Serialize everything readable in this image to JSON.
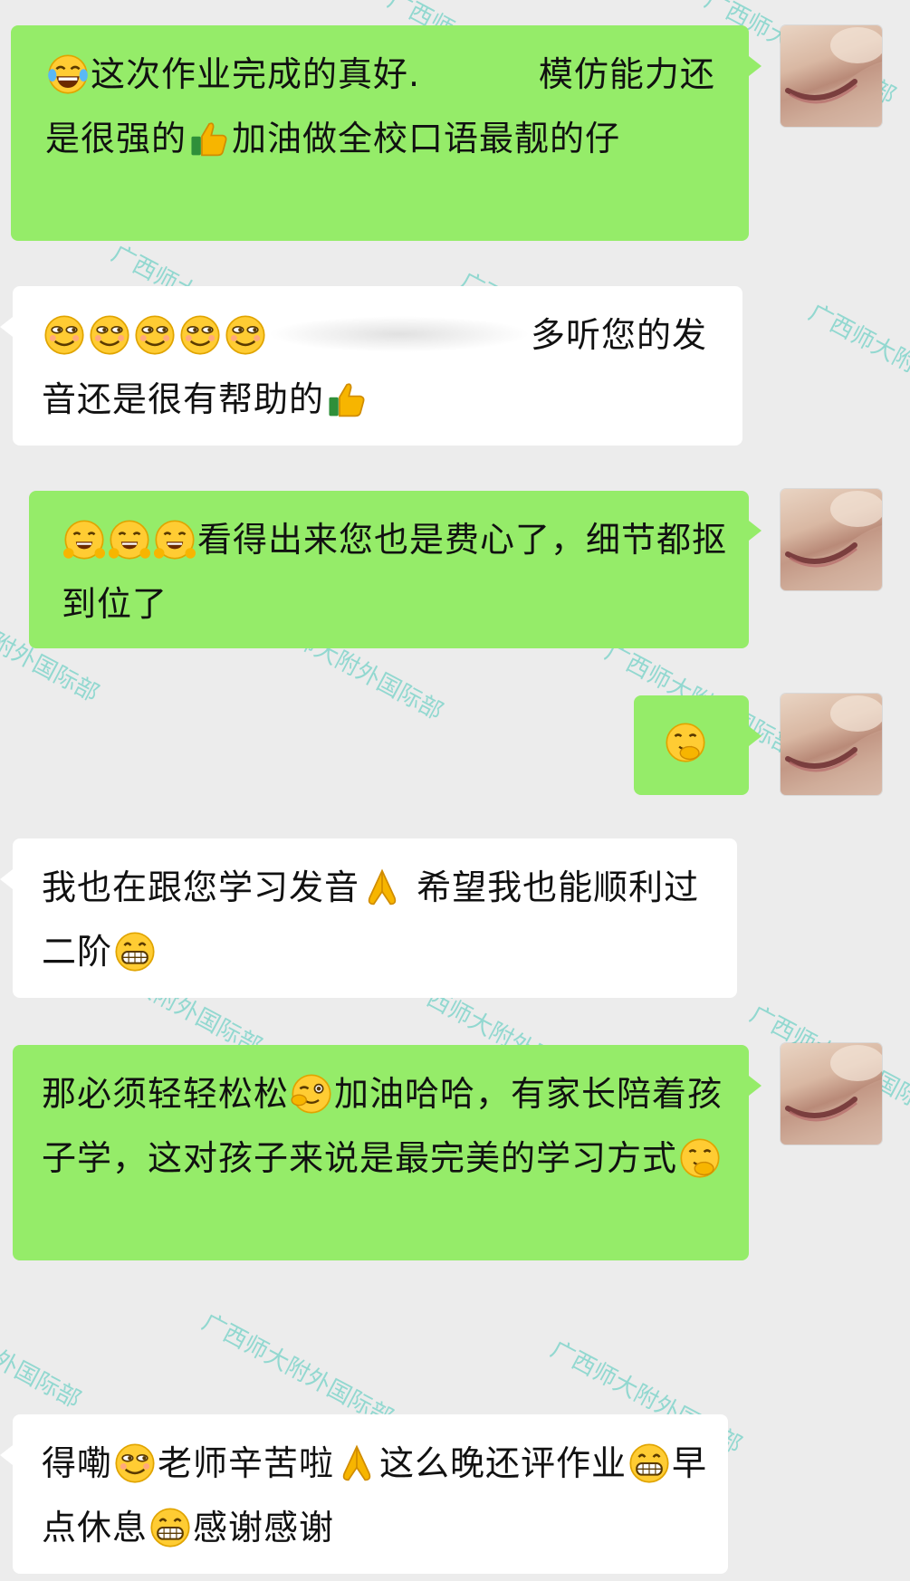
{
  "watermark_text": "广西师大附外国际部",
  "messages": [
    {
      "side": "right",
      "parts": [
        {
          "emoji": "laugh-tears-icon"
        },
        {
          "text": "这次作业完成的真好.          模仿能力还是很强的"
        },
        {
          "emoji": "thumbs-up-icon"
        },
        {
          "text": "加油做全校口语最靓的仔"
        }
      ]
    },
    {
      "side": "left",
      "parts": [
        {
          "emoji": "smirk-icon"
        },
        {
          "emoji": "smirk-icon"
        },
        {
          "emoji": "smirk-icon"
        },
        {
          "emoji": "smirk-icon"
        },
        {
          "emoji": "smirk-icon"
        },
        {
          "text": "多听您的发音还是很有帮助的"
        },
        {
          "emoji": "thumbs-up-icon"
        }
      ]
    },
    {
      "side": "right",
      "parts": [
        {
          "emoji": "grin-hands-icon"
        },
        {
          "emoji": "grin-hands-icon"
        },
        {
          "emoji": "grin-hands-icon"
        },
        {
          "text": "看得出来您也是费心了，细节都抠到位了"
        }
      ]
    },
    {
      "side": "right",
      "parts": [
        {
          "emoji": "chuckle-icon"
        }
      ]
    },
    {
      "side": "left",
      "parts": [
        {
          "text": "我也在跟您学习发音"
        },
        {
          "emoji": "pray-icon"
        },
        {
          "text": " 希望我也能顺利过二阶"
        },
        {
          "emoji": "big-grin-icon"
        }
      ]
    },
    {
      "side": "right",
      "parts": [
        {
          "text": "那必须轻轻松松"
        },
        {
          "emoji": "wink-icon"
        },
        {
          "text": "加油哈哈，有家长陪着孩子学，这对孩子来说是最完美的学习方式"
        },
        {
          "emoji": "chuckle-icon"
        }
      ]
    },
    {
      "side": "left",
      "parts": [
        {
          "text": "得嘞"
        },
        {
          "emoji": "smirk-icon"
        },
        {
          "text": "老师辛苦啦"
        },
        {
          "emoji": "pray-icon"
        },
        {
          "text": "这么晚还评作业"
        },
        {
          "emoji": "big-grin-icon"
        },
        {
          "text": "早点休息"
        },
        {
          "emoji": "big-grin-icon"
        },
        {
          "text": "感谢感谢"
        }
      ]
    }
  ]
}
